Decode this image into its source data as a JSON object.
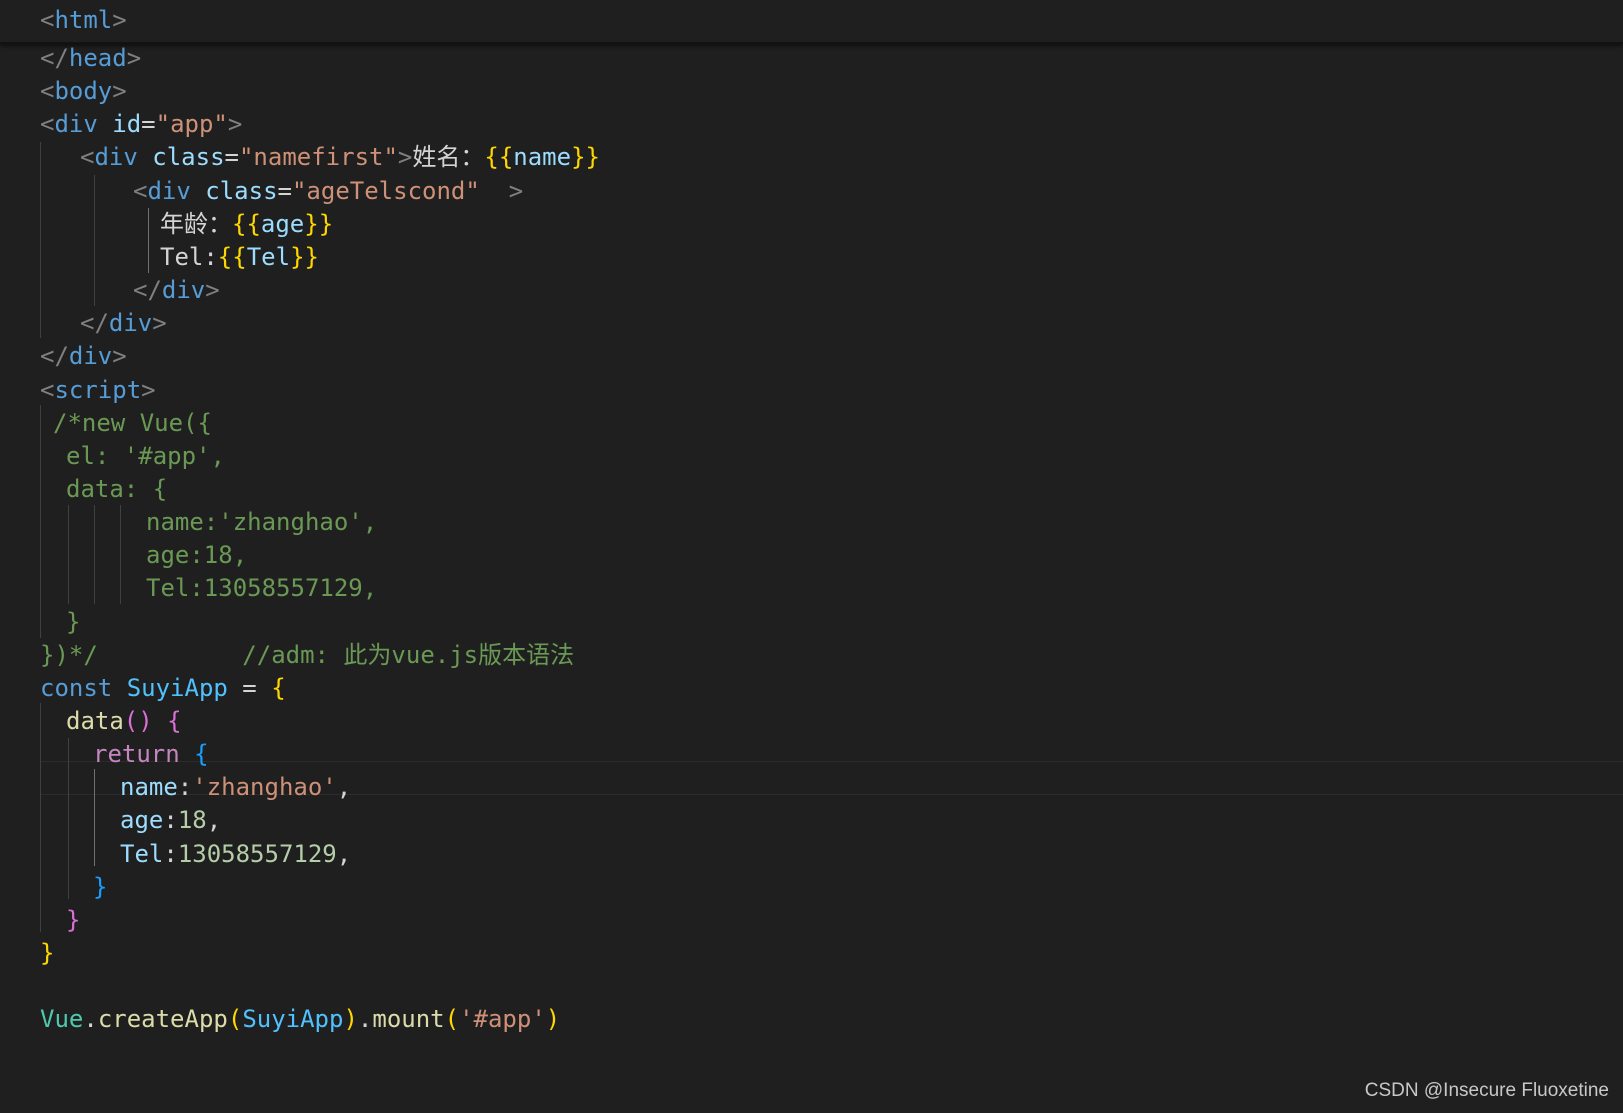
{
  "colors": {
    "background": "#1f1f1f",
    "tag_bracket": "#808080",
    "tag_name": "#569cd6",
    "attribute_name": "#9cdcfe",
    "string": "#ce9178",
    "comment": "#6a9955",
    "keyword_const": "#569cd6",
    "keyword_return": "#c586c0",
    "function_name": "#dcdcaa",
    "class_name": "#4ec9b0",
    "variable": "#9cdcfe",
    "number": "#b5cea8",
    "bracket_gold": "#ffd700",
    "bracket_purple": "#da70d6",
    "bracket_blue": "#179fff",
    "plain": "#d4d4d4"
  },
  "sticky_header": {
    "segments": [
      {
        "text": "<",
        "color": "#808080"
      },
      {
        "text": "html",
        "color": "#569cd6"
      },
      {
        "text": ">",
        "color": "#808080"
      }
    ]
  },
  "code_lines": [
    {
      "segments": [
        {
          "text": "</",
          "color": "#808080"
        },
        {
          "text": "head",
          "color": "#569cd6"
        },
        {
          "text": ">",
          "color": "#808080"
        }
      ]
    },
    {
      "segments": [
        {
          "text": "<",
          "color": "#808080"
        },
        {
          "text": "body",
          "color": "#569cd6"
        },
        {
          "text": ">",
          "color": "#808080"
        }
      ]
    },
    {
      "segments": [
        {
          "text": "<",
          "color": "#808080"
        },
        {
          "text": "div",
          "color": "#569cd6"
        },
        {
          "text": " ",
          "color": "#d4d4d4"
        },
        {
          "text": "id",
          "color": "#9cdcfe"
        },
        {
          "text": "=",
          "color": "#d4d4d4"
        },
        {
          "text": "\"app\"",
          "color": "#ce9178"
        },
        {
          "text": ">",
          "color": "#808080"
        }
      ]
    },
    {
      "segments": [
        {
          "text": "<",
          "color": "#808080"
        },
        {
          "text": "div",
          "color": "#569cd6"
        },
        {
          "text": " ",
          "color": "#d4d4d4"
        },
        {
          "text": "class",
          "color": "#9cdcfe"
        },
        {
          "text": "=",
          "color": "#d4d4d4"
        },
        {
          "text": "\"namefirst\"",
          "color": "#ce9178"
        },
        {
          "text": ">",
          "color": "#808080"
        },
        {
          "text": "姓名：",
          "color": "#d4d4d4"
        },
        {
          "text": "{{",
          "color": "#ffd700"
        },
        {
          "text": "name",
          "color": "#9cdcfe"
        },
        {
          "text": "}}",
          "color": "#ffd700"
        }
      ]
    },
    {
      "segments": [
        {
          "text": "<",
          "color": "#808080"
        },
        {
          "text": "div",
          "color": "#569cd6"
        },
        {
          "text": " ",
          "color": "#d4d4d4"
        },
        {
          "text": "class",
          "color": "#9cdcfe"
        },
        {
          "text": "=",
          "color": "#d4d4d4"
        },
        {
          "text": "\"ageTelscond\"",
          "color": "#ce9178"
        },
        {
          "text": "  ",
          "color": "#d4d4d4"
        },
        {
          "text": ">",
          "color": "#808080"
        }
      ]
    },
    {
      "segments": [
        {
          "text": "年龄：",
          "color": "#d4d4d4"
        },
        {
          "text": "{{",
          "color": "#ffd700"
        },
        {
          "text": "age",
          "color": "#9cdcfe"
        },
        {
          "text": "}}",
          "color": "#ffd700"
        }
      ]
    },
    {
      "segments": [
        {
          "text": "Tel:",
          "color": "#d4d4d4"
        },
        {
          "text": "{{",
          "color": "#ffd700"
        },
        {
          "text": "Tel",
          "color": "#9cdcfe"
        },
        {
          "text": "}}",
          "color": "#ffd700"
        }
      ]
    },
    {
      "segments": [
        {
          "text": "</",
          "color": "#808080"
        },
        {
          "text": "div",
          "color": "#569cd6"
        },
        {
          "text": ">",
          "color": "#808080"
        }
      ]
    },
    {
      "segments": [
        {
          "text": "</",
          "color": "#808080"
        },
        {
          "text": "div",
          "color": "#569cd6"
        },
        {
          "text": ">",
          "color": "#808080"
        }
      ]
    },
    {
      "segments": [
        {
          "text": "</",
          "color": "#808080"
        },
        {
          "text": "div",
          "color": "#569cd6"
        },
        {
          "text": ">",
          "color": "#808080"
        }
      ]
    },
    {
      "segments": [
        {
          "text": "<",
          "color": "#808080"
        },
        {
          "text": "script",
          "color": "#569cd6"
        },
        {
          "text": ">",
          "color": "#808080"
        }
      ]
    },
    {
      "segments": [
        {
          "text": "/*new Vue({",
          "color": "#6a9955"
        }
      ]
    },
    {
      "segments": [
        {
          "text": "el: '#app',",
          "color": "#6a9955"
        }
      ]
    },
    {
      "segments": [
        {
          "text": "data: {",
          "color": "#6a9955"
        }
      ]
    },
    {
      "segments": [
        {
          "text": "name:'zhanghao',",
          "color": "#6a9955"
        }
      ]
    },
    {
      "segments": [
        {
          "text": "age:18,",
          "color": "#6a9955"
        }
      ]
    },
    {
      "segments": [
        {
          "text": "Tel:13058557129,",
          "color": "#6a9955"
        }
      ]
    },
    {
      "segments": [
        {
          "text": "}",
          "color": "#6a9955"
        }
      ]
    },
    {
      "segments": [
        {
          "text": "})*/          //adm: 此为vue.js版本语法",
          "color": "#6a9955"
        }
      ]
    },
    {
      "segments": [
        {
          "text": "const",
          "color": "#569cd6"
        },
        {
          "text": " ",
          "color": "#d4d4d4"
        },
        {
          "text": "SuyiApp",
          "color": "#4fc1ff"
        },
        {
          "text": " = ",
          "color": "#d4d4d4"
        },
        {
          "text": "{",
          "color": "#ffd700"
        }
      ]
    },
    {
      "segments": [
        {
          "text": "data",
          "color": "#dcdcaa"
        },
        {
          "text": "()",
          "color": "#da70d6"
        },
        {
          "text": " ",
          "color": "#d4d4d4"
        },
        {
          "text": "{",
          "color": "#da70d6"
        }
      ]
    },
    {
      "segments": [
        {
          "text": "return",
          "color": "#c586c0"
        },
        {
          "text": " ",
          "color": "#d4d4d4"
        },
        {
          "text": "{",
          "color": "#179fff"
        }
      ]
    },
    {
      "segments": [
        {
          "text": "name",
          "color": "#9cdcfe"
        },
        {
          "text": ":",
          "color": "#d4d4d4"
        },
        {
          "text": "'zhanghao'",
          "color": "#ce9178"
        },
        {
          "text": ",",
          "color": "#d4d4d4"
        }
      ]
    },
    {
      "segments": [
        {
          "text": "age",
          "color": "#9cdcfe"
        },
        {
          "text": ":",
          "color": "#d4d4d4"
        },
        {
          "text": "18",
          "color": "#b5cea8"
        },
        {
          "text": ",",
          "color": "#d4d4d4"
        }
      ]
    },
    {
      "segments": [
        {
          "text": "Tel",
          "color": "#9cdcfe"
        },
        {
          "text": ":",
          "color": "#d4d4d4"
        },
        {
          "text": "13058557129",
          "color": "#b5cea8"
        },
        {
          "text": ",",
          "color": "#d4d4d4"
        }
      ]
    },
    {
      "segments": [
        {
          "text": "}",
          "color": "#179fff"
        }
      ]
    },
    {
      "segments": [
        {
          "text": "}",
          "color": "#da70d6"
        }
      ]
    },
    {
      "segments": [
        {
          "text": "}",
          "color": "#ffd700"
        }
      ]
    },
    {
      "segments": []
    },
    {
      "segments": [
        {
          "text": "Vue",
          "color": "#4ec9b0"
        },
        {
          "text": ".",
          "color": "#d4d4d4"
        },
        {
          "text": "createApp",
          "color": "#dcdcaa"
        },
        {
          "text": "(",
          "color": "#ffd700"
        },
        {
          "text": "SuyiApp",
          "color": "#4fc1ff"
        },
        {
          "text": ")",
          "color": "#ffd700"
        },
        {
          "text": ".",
          "color": "#d4d4d4"
        },
        {
          "text": "mount",
          "color": "#dcdcaa"
        },
        {
          "text": "(",
          "color": "#ffd700"
        },
        {
          "text": "'#app'",
          "color": "#ce9178"
        },
        {
          "text": ")",
          "color": "#ffd700"
        }
      ]
    }
  ],
  "watermark": "CSDN @Insecure Fluoxetine"
}
